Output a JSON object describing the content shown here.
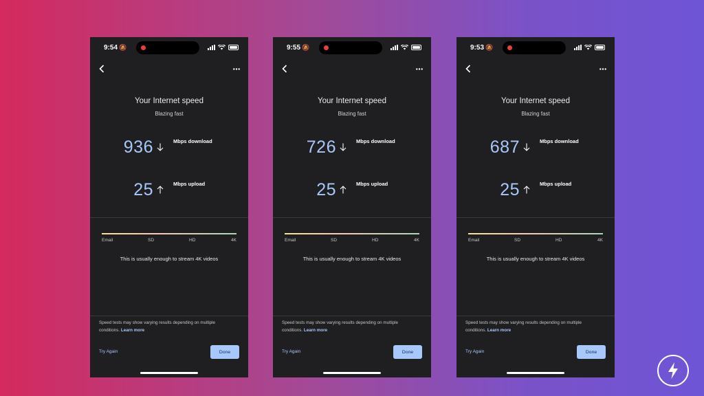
{
  "screens": [
    {
      "time": "9:54",
      "title": "Your Internet speed",
      "subtitle": "Blazing fast",
      "download_value": "936",
      "download_label": "Mbps download",
      "upload_value": "25",
      "upload_label": "Mbps upload",
      "quality_labels": [
        "Email",
        "SD",
        "HD",
        "4K"
      ],
      "stream_text": "This is usually enough to stream 4K videos",
      "disclaimer": "Speed tests may show varying results depending on multiple conditions.",
      "learn_more": "Learn more",
      "try_again": "Try Again",
      "done": "Done"
    },
    {
      "time": "9:55",
      "title": "Your Internet speed",
      "subtitle": "Blazing fast",
      "download_value": "726",
      "download_label": "Mbps download",
      "upload_value": "25",
      "upload_label": "Mbps upload",
      "quality_labels": [
        "Email",
        "SD",
        "HD",
        "4K"
      ],
      "stream_text": "This is usually enough to stream 4K videos",
      "disclaimer": "Speed tests may show varying results depending on multiple conditions.",
      "learn_more": "Learn more",
      "try_again": "Try Again",
      "done": "Done"
    },
    {
      "time": "9:53",
      "title": "Your Internet speed",
      "subtitle": "Blazing fast",
      "download_value": "687",
      "download_label": "Mbps download",
      "upload_value": "25",
      "upload_label": "Mbps upload",
      "quality_labels": [
        "Email",
        "SD",
        "HD",
        "4K"
      ],
      "stream_text": "This is usually enough to stream 4K videos",
      "disclaimer": "Speed tests may show varying results depending on multiple conditions.",
      "learn_more": "Learn more",
      "try_again": "Try Again",
      "done": "Done"
    }
  ],
  "icons": {
    "status": [
      "bell-slash-icon",
      "cellular-signal-icon",
      "wifi-icon",
      "battery-icon"
    ],
    "nav": [
      "back-arrow-icon",
      "more-horizontal-icon"
    ],
    "speed": [
      "arrow-down-icon",
      "arrow-up-icon"
    ],
    "brand": "lightning-bolt-icon"
  },
  "colors": {
    "background_left": "#d42a5e",
    "background_right": "#6e55d6",
    "screen": "#1f1f21",
    "accent": "#a8c7fa",
    "recording_dot": "#e8413c"
  }
}
